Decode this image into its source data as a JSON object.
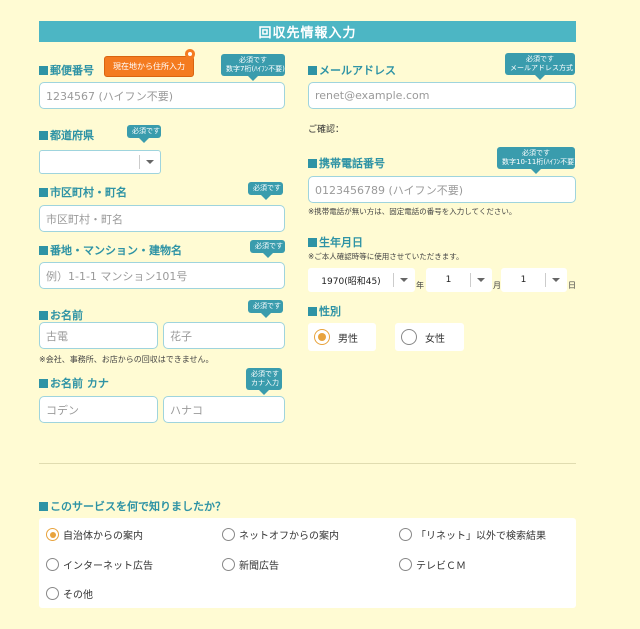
{
  "header": {
    "title": "回収先情報入力"
  },
  "postal": {
    "label": "郵便番号",
    "location_button": "現在地から住所入力",
    "badge_line1": "必須です",
    "badge_line2": "数字7桁(ﾊｲﾌﾝ不要)",
    "placeholder": "1234567 (ハイフン不要)"
  },
  "email": {
    "label": "メールアドレス",
    "badge_line1": "必須です",
    "badge_line2": "メールアドレス方式",
    "placeholder": "renet@example.com",
    "confirm_label": "ご確認："
  },
  "prefecture": {
    "label": "都道府県",
    "badge": "必須です",
    "value": ""
  },
  "mobile": {
    "label": "携帯電話番号",
    "badge_line1": "必須です",
    "badge_line2": "数字10-11桁(ﾊｲﾌﾝ不要)",
    "placeholder": "0123456789 (ハイフン不要)",
    "note": "※携帯電話が無い方は、固定電話の番号を入力してください。"
  },
  "city": {
    "label": "市区町村・町名",
    "badge": "必須です",
    "placeholder": "市区町村・町名"
  },
  "birth": {
    "label": "生年月日",
    "note": "※ご本人確認時等に使用させていただきます。",
    "year": "1970(昭和45)",
    "year_unit": "年",
    "month": "1",
    "month_unit": "月",
    "day": "1",
    "day_unit": "日"
  },
  "address": {
    "label": "番地・マンション・建物名",
    "badge": "必須です",
    "placeholder": "例）1-1-1 マンション101号"
  },
  "gender": {
    "label": "性別",
    "male": "男性",
    "female": "女性",
    "selected": "male"
  },
  "name": {
    "label": "お名前",
    "badge": "必須です",
    "last_placeholder": "古電",
    "first_placeholder": "花子",
    "note": "※会社、事務所、お店からの回収はできません。"
  },
  "kana": {
    "label": "お名前 カナ",
    "badge_line1": "必須です",
    "badge_line2": "カナ入力",
    "last_placeholder": "コデン",
    "first_placeholder": "ハナコ"
  },
  "survey": {
    "label": "このサービスを何で知りましたか？",
    "options": [
      "自治体からの案内",
      "ネットオフからの案内",
      "「リネット」以外で検索結果",
      "インターネット広告",
      "新聞広告",
      "テレビＣＭ",
      "その他"
    ],
    "selected_index": 0
  },
  "colors": {
    "accent": "#4cb6c4",
    "label": "#2e93a5",
    "badge": "#3a9cad",
    "button": "#f47b20",
    "radio_on": "#e8a33d",
    "background": "#fffbd3"
  }
}
